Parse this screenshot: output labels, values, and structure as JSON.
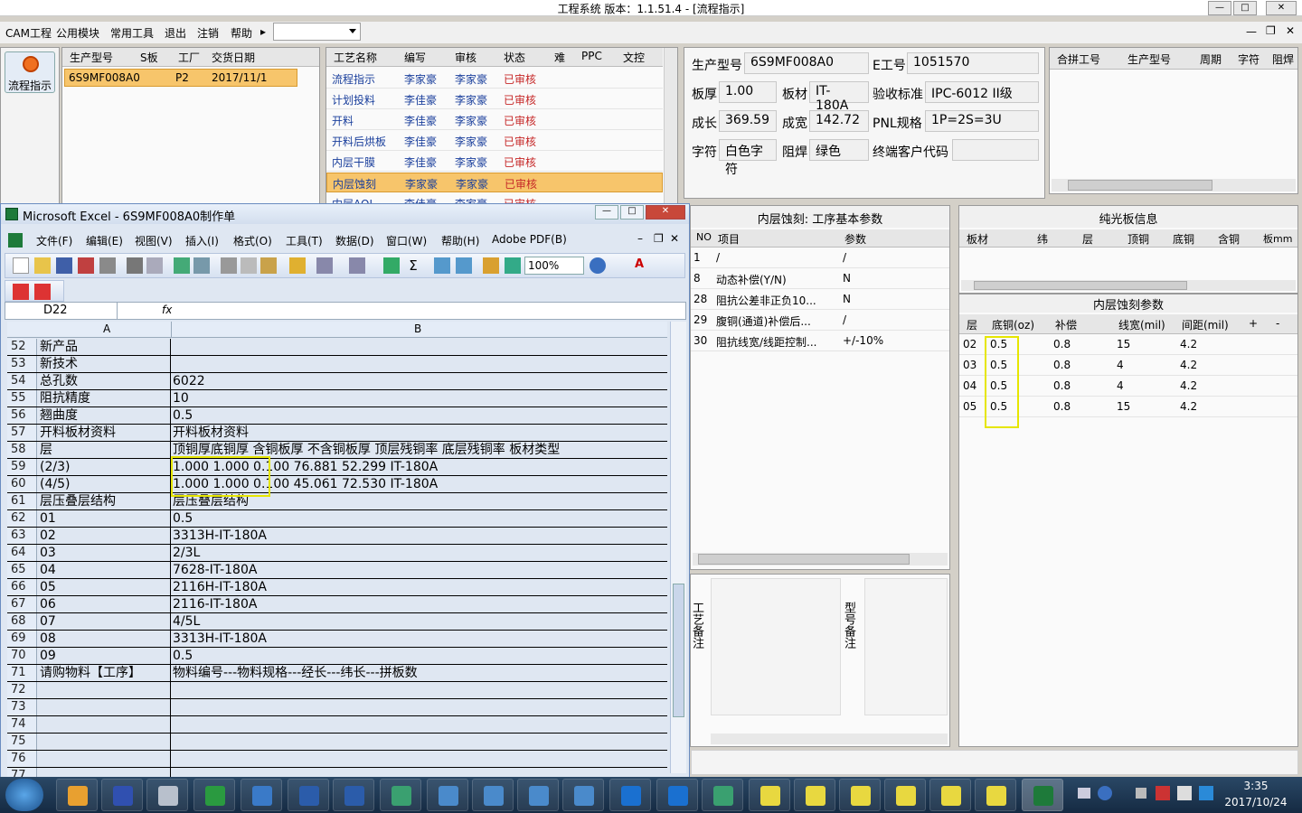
{
  "app": {
    "title": "工程系统    版本：1.1.51.4 - [流程指示]"
  },
  "menu": {
    "items": [
      "CAM工程",
      "公用模块",
      "常用工具",
      "退出",
      "注销",
      "帮助"
    ],
    "help_arrow": "▸"
  },
  "left_button": {
    "label": "流程指示"
  },
  "order_grid": {
    "headers": [
      "生产型号",
      "S板",
      "工厂",
      "交货日期"
    ],
    "row": [
      "6S9MF008A0",
      "",
      "P2",
      "2017/11/1"
    ]
  },
  "process_grid": {
    "headers": [
      "工艺名称",
      "编写",
      "审核",
      "状态",
      "难",
      "PPC",
      "文控"
    ],
    "rows": [
      [
        "流程指示",
        "李家豪",
        "李家豪",
        "已审核"
      ],
      [
        "计划投料",
        "李佳豪",
        "李家豪",
        "已审核"
      ],
      [
        "开料",
        "李佳豪",
        "李家豪",
        "已审核"
      ],
      [
        "开料后烘板",
        "李佳豪",
        "李家豪",
        "已审核"
      ],
      [
        "内层干膜",
        "李佳豪",
        "李家豪",
        "已审核"
      ],
      [
        "内层蚀刻",
        "李家豪",
        "李家豪",
        "已审核"
      ],
      [
        "内层AOI",
        "李佳豪",
        "李家豪",
        "已审核"
      ]
    ]
  },
  "info": {
    "prod_no_label": "生产型号",
    "prod_no": "6S9MF008A0",
    "eno_label": "E工号",
    "eno": "1051570",
    "thick_label": "板厚",
    "thick": "1.00",
    "mat_label": "板材",
    "mat": "IT-180A",
    "std_label": "验收标准",
    "std": "IPC-6012 II级",
    "len_label": "成长",
    "len": "369.59",
    "wid_label": "成宽",
    "wid": "142.72",
    "pnl_label": "PNL规格",
    "pnl": "1P=2S=3U",
    "char_label": "字符",
    "char": "白色字符",
    "mask_label": "阻焊",
    "mask": "绿色",
    "cust_label": "终端客户代码",
    "cust": ""
  },
  "merge_grid": {
    "headers": [
      "合拼工号",
      "生产型号",
      "周期",
      "字符",
      "阻焊"
    ]
  },
  "param_panel": {
    "title": "内层蚀刻: 工序基本参数",
    "headers": [
      "NO",
      "项目",
      "参数"
    ],
    "rows": [
      [
        "1",
        "/",
        "/"
      ],
      [
        "8",
        "动态补偿(Y/N)",
        "N"
      ],
      [
        "28",
        "阻抗公差非正负10...",
        "N"
      ],
      [
        "29",
        "腹铜(通道)补偿后...",
        "/"
      ],
      [
        "30",
        "阻抗线宽/线距控制...",
        "+/-10%"
      ]
    ]
  },
  "notes": {
    "process_note": "工艺备注",
    "model_note": "型号备注"
  },
  "laminate": {
    "title": "纯光板信息",
    "headers": [
      "板材",
      "纬",
      "层",
      "顶铜",
      "底铜",
      "含铜",
      "板mm"
    ]
  },
  "etch": {
    "title": "内层蚀刻参数",
    "headers": [
      "层",
      "底铜(oz)",
      "补偿",
      "线宽(mil)",
      "间距(mil)",
      "+",
      "-"
    ],
    "rows": [
      [
        "02",
        "0.5",
        "0.8",
        "15",
        "4.2"
      ],
      [
        "03",
        "0.5",
        "0.8",
        "4",
        "4.2"
      ],
      [
        "04",
        "0.5",
        "0.8",
        "4",
        "4.2"
      ],
      [
        "05",
        "0.5",
        "0.8",
        "15",
        "4.2"
      ]
    ]
  },
  "excel": {
    "title": "Microsoft Excel - 6S9MF008A0制作单",
    "menu": [
      "文件(F)",
      "编辑(E)",
      "视图(V)",
      "插入(I)",
      "格式(O)",
      "工具(T)",
      "数据(D)",
      "窗口(W)",
      "帮助(H)",
      "Adobe PDF(B)"
    ],
    "zoom": "100%",
    "namebox": "D22",
    "fx": "fx",
    "col_a": "A",
    "col_b": "B",
    "rows": [
      {
        "n": "52",
        "a": "新产品",
        "b": ""
      },
      {
        "n": "53",
        "a": "新技术",
        "b": ""
      },
      {
        "n": "54",
        "a": "总孔数",
        "b": "6022"
      },
      {
        "n": "55",
        "a": "阻抗精度",
        "b": "10"
      },
      {
        "n": "56",
        "a": "翘曲度",
        "b": "0.5"
      },
      {
        "n": "57",
        "a": "开料板材资料",
        "b": "开料板材资料"
      },
      {
        "n": "58",
        "a": "层",
        "b": "顶铜厚底铜厚 含铜板厚 不含铜板厚  顶层残铜率  底层残铜率  板材类型"
      },
      {
        "n": "59",
        "a": "(2/3)",
        "b": "1.000   1.000            0.100        76.881      52.299         IT-180A"
      },
      {
        "n": "60",
        "a": "(4/5)",
        "b": "1.000   1.000            0.100        45.061      72.530         IT-180A"
      },
      {
        "n": "61",
        "a": "层压叠层结构",
        "b": "层压叠层结构"
      },
      {
        "n": "62",
        "a": "01",
        "b": "0.5"
      },
      {
        "n": "63",
        "a": "02",
        "b": "3313H-IT-180A"
      },
      {
        "n": "64",
        "a": "03",
        "b": "2/3L"
      },
      {
        "n": "65",
        "a": "04",
        "b": "7628-IT-180A"
      },
      {
        "n": "66",
        "a": "05",
        "b": "2116H-IT-180A"
      },
      {
        "n": "67",
        "a": "06",
        "b": "2116-IT-180A"
      },
      {
        "n": "68",
        "a": "07",
        "b": "4/5L"
      },
      {
        "n": "69",
        "a": "08",
        "b": "3313H-IT-180A"
      },
      {
        "n": "70",
        "a": "09",
        "b": "0.5"
      },
      {
        "n": "71",
        "a": "请购物料【工序】",
        "b": "物料编号---物料规格---经长---纬长---拼板数"
      },
      {
        "n": "72",
        "a": "",
        "b": ""
      },
      {
        "n": "73",
        "a": "",
        "b": ""
      },
      {
        "n": "74",
        "a": "",
        "b": ""
      },
      {
        "n": "75",
        "a": "",
        "b": ""
      },
      {
        "n": "76",
        "a": "",
        "b": ""
      },
      {
        "n": "77",
        "a": "",
        "b": ""
      }
    ]
  },
  "tray": {
    "time": "3:35",
    "date": "2017/10/24"
  },
  "colors": {
    "highlight": "#e6e600",
    "selected_row": "#f7c56b",
    "accent": "#1a3f9c"
  }
}
